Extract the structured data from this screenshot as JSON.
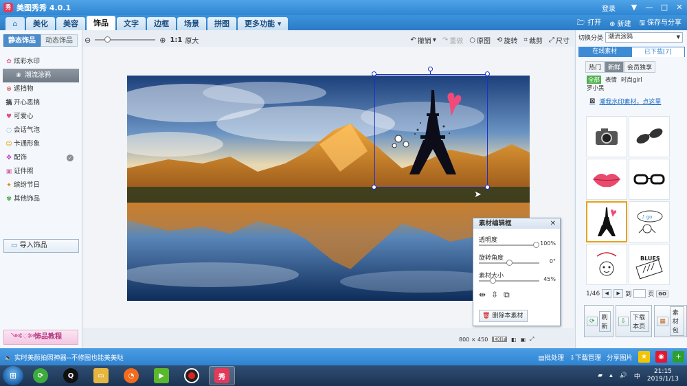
{
  "window": {
    "title": "美图秀秀 4.0.1",
    "app_icon": "秀",
    "login": "登录",
    "controls": [
      "▼",
      "—",
      "□",
      "✕"
    ]
  },
  "nav": {
    "tabs": [
      "美化",
      "美容",
      "饰品",
      "文字",
      "边框",
      "场景",
      "拼图"
    ],
    "active_tab": "饰品",
    "more": "更多功能",
    "open": "打开",
    "new": "新建",
    "save_share": "保存与分享"
  },
  "left": {
    "tab_static": "静态饰品",
    "tab_dynamic": "动态饰品",
    "items": [
      {
        "icon": "✿",
        "label": "炫彩水印"
      },
      {
        "icon": "❀",
        "label": "潮流涂鸦"
      },
      {
        "icon": "⊗",
        "label": "遮挡物"
      },
      {
        "icon": "搞",
        "label": "开心恶搞"
      },
      {
        "icon": "♥",
        "label": "可爱心"
      },
      {
        "icon": "◌",
        "label": "会话气泡"
      },
      {
        "icon": "☺",
        "label": "卡通形象"
      },
      {
        "icon": "✤",
        "label": "配饰"
      },
      {
        "icon": "▣",
        "label": "证件照"
      },
      {
        "icon": "✦",
        "label": "缤纷节日"
      },
      {
        "icon": "✾",
        "label": "其他饰品"
      }
    ],
    "active_item": "潮流涂鸦",
    "import": "导入饰品",
    "tutorial": "饰品教程"
  },
  "toolbar": {
    "zoom_ratio": "1:1",
    "original_size": "原大",
    "undo": "撤销",
    "redo": "重做",
    "original": "原图",
    "rotate": "旋转",
    "crop": "裁剪",
    "resize": "尺寸"
  },
  "dialog": {
    "title": "素材编辑框",
    "opacity_label": "透明度",
    "opacity_value": "100%",
    "opacity_level": 1.0,
    "rotation_label": "旋转角度",
    "rotation_value": "0°",
    "rotation_level": 0.5,
    "size_label": "素材大小",
    "size_value": "45%",
    "size_level": 0.2,
    "delete": "删除本素材"
  },
  "canvas_info": {
    "size": "800 × 450",
    "exif": "EXIF"
  },
  "right": {
    "switch_label": "切换分类",
    "category": "潮流涂鸦",
    "tab_online": "在线素材",
    "tab_downloaded": "已下载[7]",
    "sub_hot": "热门",
    "sub_new": "新鲜",
    "sub_vip": "会员独享",
    "filter_all": "全部",
    "filter_emotion": "表情",
    "filter_girl": "时尚girl",
    "filter_luo": "罗小黑",
    "link": "潮我水印素材，点这里",
    "page": "1/46",
    "go_to": "到",
    "page_unit": "页",
    "go": "GO",
    "refresh": "刷新",
    "download_page": "下载本页",
    "pack": "素材包"
  },
  "status": {
    "text": "实时美颜拍照神器--不修图也能美美哒",
    "batch": "批处理",
    "download_mgr": "下载管理",
    "share_pic": "分享图片"
  },
  "taskbar": {
    "time": "21:15",
    "date": "2019/1/13"
  },
  "colors": {
    "accent": "#2f86d3",
    "selection": "#1a2fd0",
    "selected_cell": "#e6a21a"
  }
}
